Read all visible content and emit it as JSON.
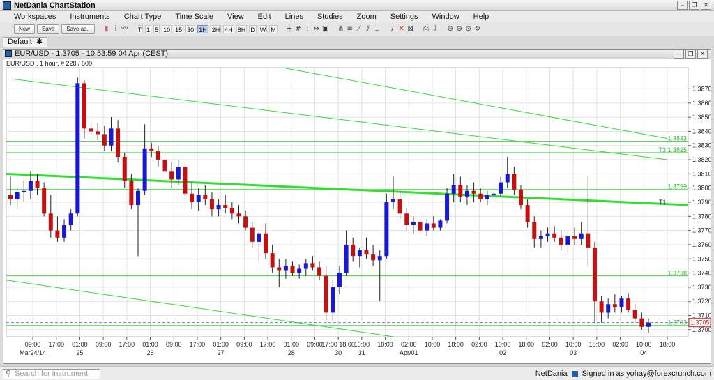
{
  "app": {
    "title": "NetDania ChartStation"
  },
  "menu": [
    "Workspaces",
    "Instruments",
    "Chart Type",
    "Time Scale",
    "View",
    "Edit",
    "Lines",
    "Studies",
    "Zoom",
    "Settings",
    "Window",
    "Help"
  ],
  "toolbar": {
    "new_label": "New",
    "save_label": "Save",
    "saveas_label": "Save as..",
    "intervals": [
      "T",
      "1",
      "5",
      "10",
      "15",
      "30",
      "1H",
      "2H",
      "4H",
      "8H",
      "D",
      "W",
      "M"
    ],
    "active_interval": "1H"
  },
  "workspace_tab": {
    "label": "Default",
    "close": "✱"
  },
  "chart_window": {
    "title": "EUR/USD - 1.3705 - 10:53:59  04 Apr (CEST)",
    "subtitle": "EUR/USD , 1 hour, # 228 / 500"
  },
  "status": {
    "search_placeholder": "Search for instrument",
    "provider": "NetDania",
    "signed_in": "Signed in as yohay@forexcrunch.com"
  },
  "colors": {
    "bull": "#1818d6",
    "bear": "#c41010",
    "line": "#33dd33",
    "grid": "#e2e2e2",
    "last_price": "#cc2222"
  },
  "chart_data": {
    "type": "candlestick",
    "symbol": "EUR/USD",
    "ylim": [
      1.3695,
      1.3885
    ],
    "y_ticks": [
      1.37,
      1.371,
      1.372,
      1.373,
      1.374,
      1.375,
      1.376,
      1.377,
      1.378,
      1.379,
      1.38,
      1.381,
      1.382,
      1.383,
      1.384,
      1.385,
      1.386,
      1.387
    ],
    "x_ticks": [
      "09:00",
      "17:00",
      "01:00",
      "09:00",
      "17:00",
      "01:00",
      "09:00",
      "17:00",
      "01:00",
      "09:00",
      "17:00",
      "01:00",
      "09:00",
      "17:00 18:00",
      "10:00",
      "18:00",
      "02:00",
      "10:00",
      "18:00",
      "02:00",
      "10:00",
      "18:00",
      "02:00",
      "10:00",
      "18:00",
      "02:00",
      "10:00",
      "18:00"
    ],
    "x_dates": [
      "Mar24/14",
      "25",
      "26",
      "27",
      "28",
      "30",
      "31",
      "Apr/01",
      "02",
      "03",
      "04"
    ],
    "last_price": "1.3705",
    "levels": [
      {
        "label": "1.3833",
        "value": 1.3833
      },
      {
        "label": "T3  1.3825",
        "value": 1.3825
      },
      {
        "label": "1.3799",
        "value": 1.3799
      },
      {
        "label": "1.3738",
        "value": 1.3738
      },
      {
        "label": "1.3703",
        "value": 1.3703
      }
    ],
    "trend_label": "T1",
    "candles": [
      [
        1.3795,
        1.3808,
        1.3788,
        1.3792
      ],
      [
        1.3792,
        1.38,
        1.3785,
        1.3797
      ],
      [
        1.3797,
        1.3805,
        1.379,
        1.3798
      ],
      [
        1.3798,
        1.3812,
        1.3792,
        1.3805
      ],
      [
        1.3805,
        1.381,
        1.3795,
        1.38
      ],
      [
        1.38,
        1.3804,
        1.378,
        1.3782
      ],
      [
        1.3782,
        1.3795,
        1.3765,
        1.377
      ],
      [
        1.377,
        1.378,
        1.3762,
        1.3765
      ],
      [
        1.3765,
        1.3778,
        1.3762,
        1.3774
      ],
      [
        1.3774,
        1.3785,
        1.377,
        1.3782
      ],
      [
        1.3782,
        1.3878,
        1.378,
        1.3874
      ],
      [
        1.3874,
        1.3876,
        1.3835,
        1.3842
      ],
      [
        1.3842,
        1.3848,
        1.3836,
        1.384
      ],
      [
        1.384,
        1.3846,
        1.3834,
        1.3838
      ],
      [
        1.3838,
        1.3844,
        1.3826,
        1.383
      ],
      [
        1.383,
        1.385,
        1.3826,
        1.3842
      ],
      [
        1.3842,
        1.3848,
        1.3818,
        1.3822
      ],
      [
        1.3822,
        1.3825,
        1.38,
        1.3805
      ],
      [
        1.3805,
        1.381,
        1.3785,
        1.3788
      ],
      [
        1.3788,
        1.38,
        1.3752,
        1.3798
      ],
      [
        1.3798,
        1.3845,
        1.3795,
        1.3828
      ],
      [
        1.3828,
        1.3832,
        1.3822,
        1.3826
      ],
      [
        1.3826,
        1.383,
        1.3815,
        1.382
      ],
      [
        1.382,
        1.3825,
        1.3808,
        1.3812
      ],
      [
        1.3812,
        1.3818,
        1.38,
        1.3806
      ],
      [
        1.3806,
        1.382,
        1.3802,
        1.3815
      ],
      [
        1.3815,
        1.3818,
        1.3792,
        1.3796
      ],
      [
        1.3796,
        1.3804,
        1.3785,
        1.379
      ],
      [
        1.379,
        1.38,
        1.3784,
        1.3795
      ],
      [
        1.3795,
        1.3802,
        1.3788,
        1.3792
      ],
      [
        1.3792,
        1.3797,
        1.378,
        1.3785
      ],
      [
        1.3785,
        1.3792,
        1.378,
        1.3788
      ],
      [
        1.3788,
        1.3795,
        1.3782,
        1.3786
      ],
      [
        1.3786,
        1.379,
        1.3778,
        1.3782
      ],
      [
        1.3782,
        1.3788,
        1.3775,
        1.378
      ],
      [
        1.378,
        1.3784,
        1.377,
        1.3772
      ],
      [
        1.3772,
        1.3776,
        1.3758,
        1.3762
      ],
      [
        1.3762,
        1.377,
        1.3748,
        1.3768
      ],
      [
        1.3768,
        1.3775,
        1.375,
        1.3754
      ],
      [
        1.3754,
        1.376,
        1.374,
        1.3744
      ],
      [
        1.3744,
        1.375,
        1.373,
        1.3742
      ],
      [
        1.3742,
        1.375,
        1.3736,
        1.3745
      ],
      [
        1.3745,
        1.3748,
        1.3738,
        1.374
      ],
      [
        1.374,
        1.3746,
        1.3736,
        1.3743
      ],
      [
        1.3743,
        1.375,
        1.3738,
        1.3747
      ],
      [
        1.3747,
        1.3752,
        1.3742,
        1.3744
      ],
      [
        1.3744,
        1.3748,
        1.3735,
        1.3738
      ],
      [
        1.3738,
        1.3745,
        1.3704,
        1.3712
      ],
      [
        1.3712,
        1.3735,
        1.3706,
        1.373
      ],
      [
        1.373,
        1.3745,
        1.3725,
        1.374
      ],
      [
        1.374,
        1.377,
        1.3738,
        1.376
      ],
      [
        1.376,
        1.3765,
        1.3748,
        1.3752
      ],
      [
        1.3752,
        1.3758,
        1.3744,
        1.3756
      ],
      [
        1.3756,
        1.3765,
        1.375,
        1.3753
      ],
      [
        1.3753,
        1.376,
        1.3745,
        1.3749
      ],
      [
        1.3749,
        1.3756,
        1.372,
        1.3752
      ],
      [
        1.3752,
        1.3796,
        1.375,
        1.379
      ],
      [
        1.379,
        1.3808,
        1.3785,
        1.3792
      ],
      [
        1.3792,
        1.3798,
        1.3778,
        1.3782
      ],
      [
        1.3782,
        1.3786,
        1.377,
        1.3774
      ],
      [
        1.3774,
        1.378,
        1.3768,
        1.3776
      ],
      [
        1.3776,
        1.378,
        1.3768,
        1.377
      ],
      [
        1.377,
        1.3778,
        1.3766,
        1.3775
      ],
      [
        1.3775,
        1.378,
        1.377,
        1.3772
      ],
      [
        1.3772,
        1.3778,
        1.377,
        1.3777
      ],
      [
        1.3777,
        1.38,
        1.3775,
        1.3796
      ],
      [
        1.3796,
        1.381,
        1.379,
        1.3802
      ],
      [
        1.3802,
        1.3808,
        1.379,
        1.3794
      ],
      [
        1.3794,
        1.3802,
        1.3788,
        1.3798
      ],
      [
        1.3798,
        1.3804,
        1.379,
        1.3796
      ],
      [
        1.3796,
        1.38,
        1.379,
        1.3792
      ],
      [
        1.3792,
        1.3798,
        1.3788,
        1.3795
      ],
      [
        1.3795,
        1.38,
        1.379,
        1.3796
      ],
      [
        1.3796,
        1.3808,
        1.3794,
        1.3804
      ],
      [
        1.3804,
        1.3822,
        1.38,
        1.381
      ],
      [
        1.381,
        1.3815,
        1.3795,
        1.3799
      ],
      [
        1.3799,
        1.3802,
        1.3785,
        1.3788
      ],
      [
        1.3788,
        1.3792,
        1.3772,
        1.3776
      ],
      [
        1.3776,
        1.378,
        1.3758,
        1.3764
      ],
      [
        1.3764,
        1.377,
        1.3758,
        1.3766
      ],
      [
        1.3766,
        1.3772,
        1.3762,
        1.3768
      ],
      [
        1.3768,
        1.3773,
        1.3762,
        1.3765
      ],
      [
        1.3765,
        1.377,
        1.3756,
        1.376
      ],
      [
        1.376,
        1.377,
        1.3755,
        1.3766
      ],
      [
        1.3766,
        1.3772,
        1.376,
        1.3764
      ],
      [
        1.3764,
        1.3776,
        1.376,
        1.3768
      ],
      [
        1.3768,
        1.3808,
        1.3745,
        1.3758
      ],
      [
        1.3758,
        1.3762,
        1.3705,
        1.372
      ],
      [
        1.372,
        1.3724,
        1.3705,
        1.3712
      ],
      [
        1.3712,
        1.3722,
        1.3708,
        1.3718
      ],
      [
        1.3718,
        1.3725,
        1.3712,
        1.3716
      ],
      [
        1.3716,
        1.3724,
        1.3712,
        1.3722
      ],
      [
        1.3722,
        1.3726,
        1.3712,
        1.3714
      ],
      [
        1.3714,
        1.3718,
        1.3705,
        1.3708
      ],
      [
        1.3708,
        1.3712,
        1.37,
        1.3702
      ],
      [
        1.3702,
        1.3708,
        1.3698,
        1.3705
      ]
    ]
  }
}
